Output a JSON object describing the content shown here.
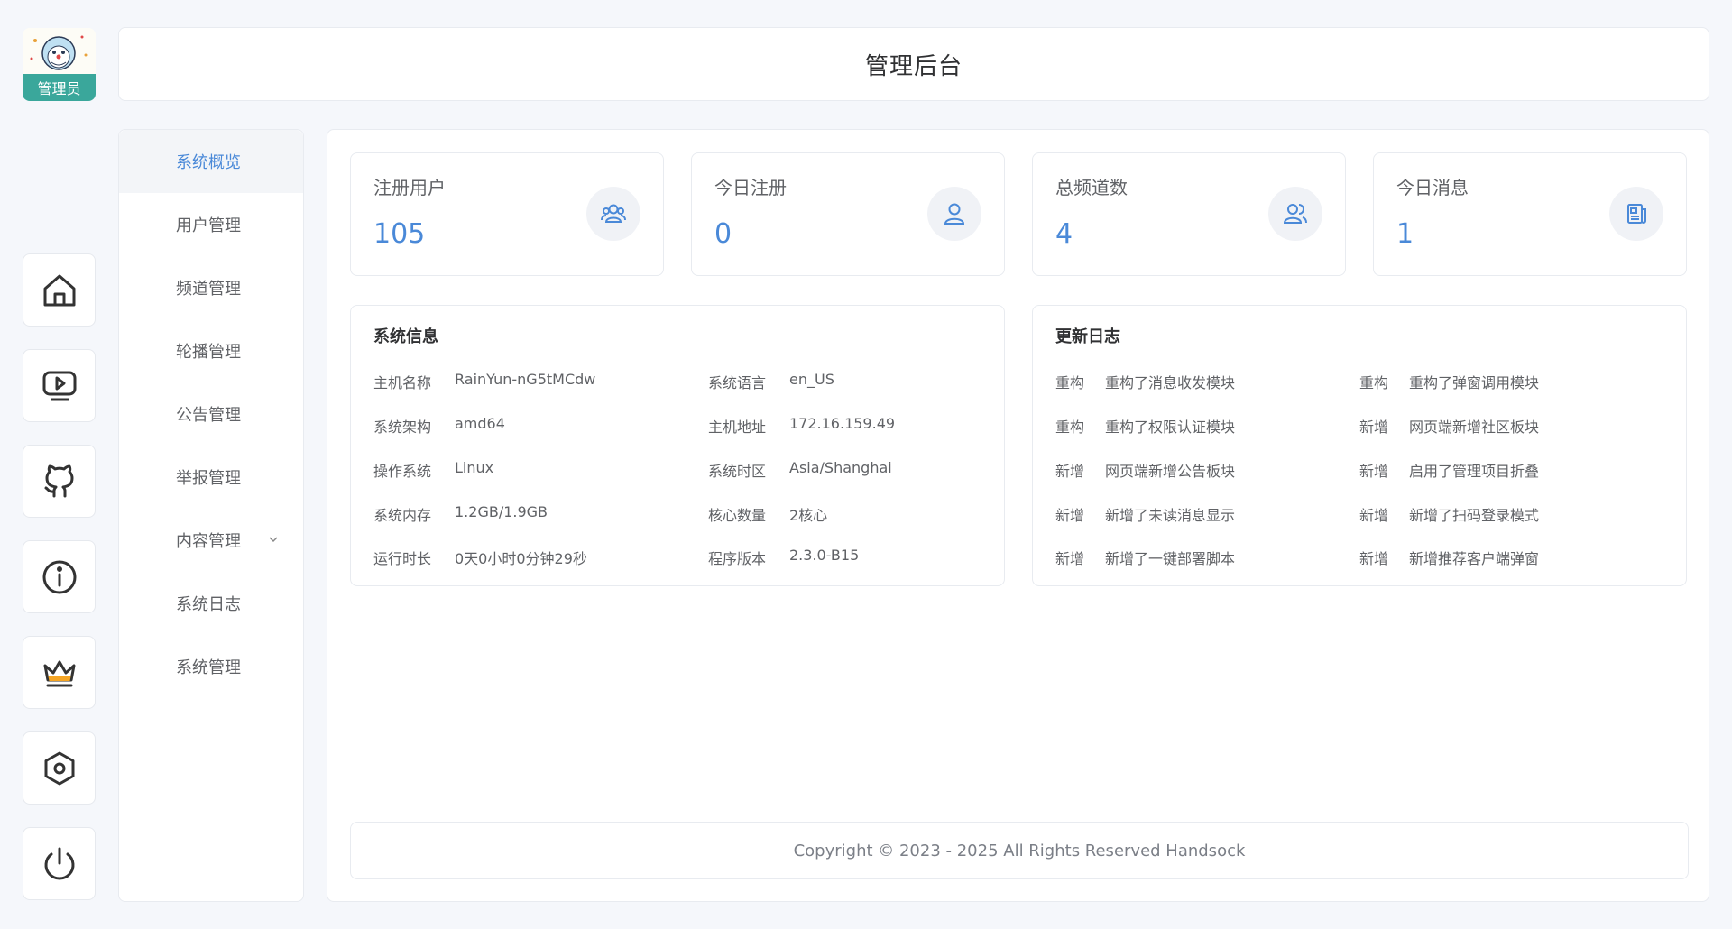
{
  "app": {
    "title": "管理后台",
    "avatar_label": "管理员"
  },
  "rail": [
    {
      "icon": "home-icon"
    },
    {
      "icon": "video-screen-icon"
    },
    {
      "icon": "github-icon"
    },
    {
      "icon": "info-icon"
    },
    {
      "icon": "crown-icon"
    },
    {
      "icon": "settings-hexagon-icon"
    },
    {
      "icon": "power-icon"
    }
  ],
  "menu": [
    {
      "label": "系统概览",
      "active": true
    },
    {
      "label": "用户管理"
    },
    {
      "label": "频道管理"
    },
    {
      "label": "轮播管理"
    },
    {
      "label": "公告管理"
    },
    {
      "label": "举报管理"
    },
    {
      "label": "内容管理",
      "has_submenu": true
    },
    {
      "label": "系统日志"
    },
    {
      "label": "系统管理"
    }
  ],
  "stats": [
    {
      "label": "注册用户",
      "value": "105",
      "icon": "users-icon"
    },
    {
      "label": "今日注册",
      "value": "0",
      "icon": "user-icon"
    },
    {
      "label": "总频道数",
      "value": "4",
      "icon": "group-icon"
    },
    {
      "label": "今日消息",
      "value": "1",
      "icon": "document-icon"
    }
  ],
  "system_info": {
    "title": "系统信息",
    "left": [
      {
        "k": "主机名称",
        "v": "RainYun-nG5tMCdw"
      },
      {
        "k": "系统架构",
        "v": "amd64"
      },
      {
        "k": "操作系统",
        "v": "Linux"
      },
      {
        "k": "系统内存",
        "v": "1.2GB/1.9GB"
      },
      {
        "k": "运行时长",
        "v": "0天0小时0分钟29秒"
      }
    ],
    "right": [
      {
        "k": "系统语言",
        "v": "en_US"
      },
      {
        "k": "主机地址",
        "v": "172.16.159.49"
      },
      {
        "k": "系统时区",
        "v": "Asia/Shanghai"
      },
      {
        "k": "核心数量",
        "v": "2核心"
      },
      {
        "k": "程序版本",
        "v": "2.3.0-B15"
      }
    ]
  },
  "changelog": {
    "title": "更新日志",
    "left": [
      {
        "k": "重构",
        "v": "重构了消息收发模块"
      },
      {
        "k": "重构",
        "v": "重构了权限认证模块"
      },
      {
        "k": "新增",
        "v": "网页端新增公告板块"
      },
      {
        "k": "新增",
        "v": "新增了未读消息显示"
      },
      {
        "k": "新增",
        "v": "新增了一键部署脚本"
      }
    ],
    "right": [
      {
        "k": "重构",
        "v": "重构了弹窗调用模块"
      },
      {
        "k": "新增",
        "v": "网页端新增社区板块"
      },
      {
        "k": "新增",
        "v": "启用了管理项目折叠"
      },
      {
        "k": "新增",
        "v": "新增了扫码登录模式"
      },
      {
        "k": "新增",
        "v": "新增推荐客户端弹窗"
      }
    ]
  },
  "footer": {
    "copyright": "Copyright © 2023 - 2025 All Rights Reserved Handsock"
  },
  "colors": {
    "accent": "#4a89d8",
    "avatar_tag": "#3aa79b",
    "crown": "#f5a524"
  }
}
